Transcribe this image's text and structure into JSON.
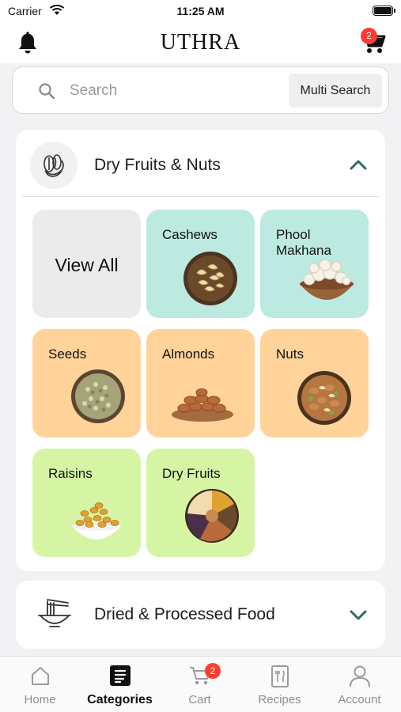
{
  "status": {
    "carrier": "Carrier",
    "time": "11:25 AM"
  },
  "header": {
    "logo": "UTHRA",
    "cart_count": "2"
  },
  "search": {
    "placeholder": "Search",
    "multi_label": "Multi Search"
  },
  "sections": [
    {
      "title": "Dry Fruits & Nuts",
      "expanded": true,
      "tiles": [
        {
          "label": "View All",
          "color": "#ebebeb"
        },
        {
          "label": "Cashews",
          "color": "#bdeae0"
        },
        {
          "label": "Phool Makhana",
          "color": "#bdeae0"
        },
        {
          "label": "Seeds",
          "color": "#ffd39a"
        },
        {
          "label": "Almonds",
          "color": "#ffd39a"
        },
        {
          "label": "Nuts",
          "color": "#ffd39a"
        },
        {
          "label": "Raisins",
          "color": "#d6f5a4"
        },
        {
          "label": "Dry Fruits",
          "color": "#d6f5a4"
        }
      ]
    },
    {
      "title": "Dried & Processed Food",
      "expanded": false
    }
  ],
  "tabbar": {
    "items": [
      {
        "label": "Home",
        "icon": "home-icon"
      },
      {
        "label": "Categories",
        "icon": "categories-icon",
        "active": true
      },
      {
        "label": "Cart",
        "icon": "cart-icon",
        "badge": "2"
      },
      {
        "label": "Recipes",
        "icon": "recipes-icon"
      },
      {
        "label": "Account",
        "icon": "account-icon"
      }
    ]
  },
  "colors": {
    "accent_teal": "#2f6b62",
    "badge_red": "#ff3b30"
  }
}
